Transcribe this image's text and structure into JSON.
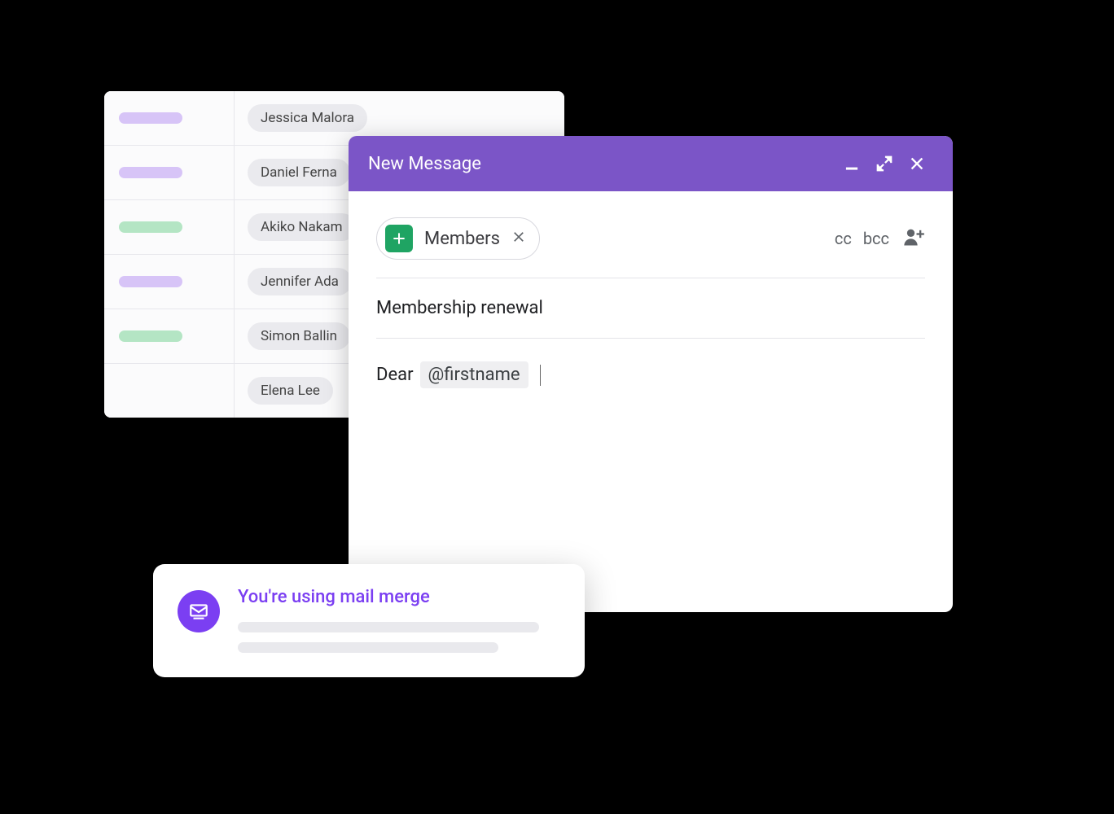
{
  "spreadsheet": {
    "rows": [
      {
        "color": "purple",
        "name": "Jessica Malora"
      },
      {
        "color": "purple",
        "name": "Daniel Ferna"
      },
      {
        "color": "green",
        "name": "Akiko Nakam"
      },
      {
        "color": "purple",
        "name": "Jennifer Ada"
      },
      {
        "color": "green",
        "name": "Simon Ballin"
      },
      {
        "color": "",
        "name": "Elena Lee"
      }
    ]
  },
  "compose": {
    "title": "New Message",
    "recipient_chip": "Members",
    "cc": "cc",
    "bcc": "bcc",
    "subject": "Membership renewal",
    "body_greeting": "Dear",
    "merge_tag": "@firstname"
  },
  "toast": {
    "title": "You're using mail merge"
  }
}
